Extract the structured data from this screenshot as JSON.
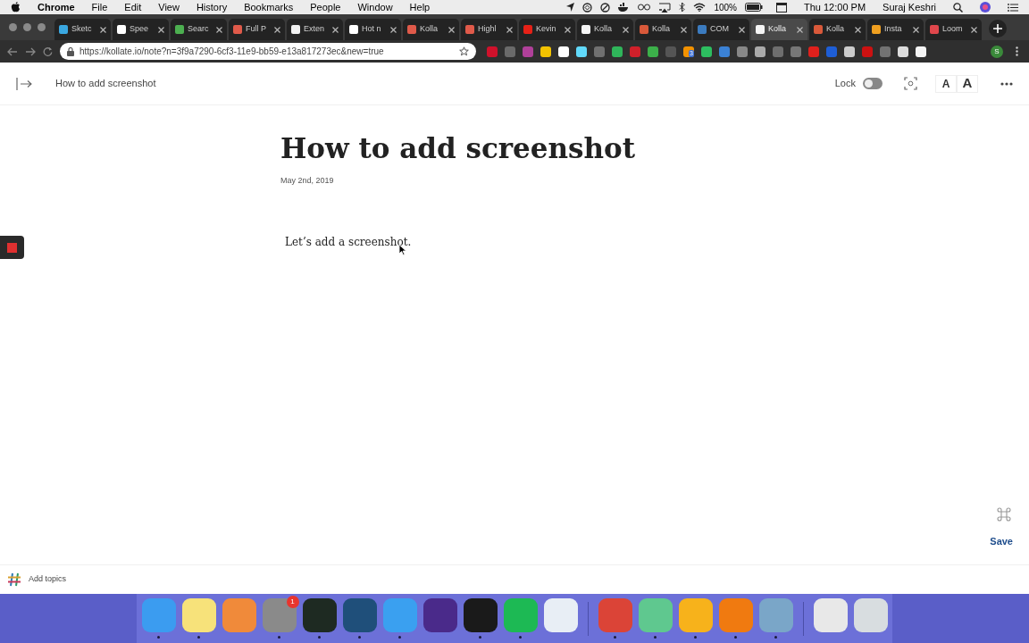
{
  "menu_bar": {
    "app": "Chrome",
    "items": [
      "File",
      "Edit",
      "View",
      "History",
      "Bookmarks",
      "People",
      "Window",
      "Help"
    ],
    "battery": "100%",
    "clock": "Thu 12:00 PM",
    "user": "Suraj Keshri"
  },
  "tabs": [
    {
      "label": "Sketc",
      "selected": false,
      "color": "#3aa7e0"
    },
    {
      "label": "Spee",
      "selected": false,
      "color": "#ffffff"
    },
    {
      "label": "Searc",
      "selected": false,
      "color": "#4caf50"
    },
    {
      "label": "Full P",
      "selected": false,
      "color": "#e05a4a"
    },
    {
      "label": "Exten",
      "selected": false,
      "color": "#f0f0f0"
    },
    {
      "label": "Hot n",
      "selected": false,
      "color": "#ffffff"
    },
    {
      "label": "Kolla",
      "selected": false,
      "color": "#e05a4a"
    },
    {
      "label": "Highl",
      "selected": false,
      "color": "#e05a4a"
    },
    {
      "label": "Kevin",
      "selected": false,
      "color": "#e62117"
    },
    {
      "label": "Kolla",
      "selected": false,
      "color": "#f5f5f5"
    },
    {
      "label": "Kolla",
      "selected": false,
      "color": "#d9593a"
    },
    {
      "label": "COM",
      "selected": false,
      "color": "#3b7bbf"
    },
    {
      "label": "Kolla",
      "selected": true,
      "color": "#f5f5f5"
    },
    {
      "label": "Kolla",
      "selected": false,
      "color": "#d9593a"
    },
    {
      "label": "Insta",
      "selected": false,
      "color": "#f0a020"
    },
    {
      "label": "Loom",
      "selected": false,
      "color": "#e0474c"
    }
  ],
  "address_bar": {
    "url": "https://kollate.io/note?n=3f9a7290-6cf3-11e9-bb59-e13a817273ec&new=true"
  },
  "extensions": [
    {
      "color": "#d0112b"
    },
    {
      "color": "#6a6a6a"
    },
    {
      "color": "#b0409a"
    },
    {
      "color": "#f2c200"
    },
    {
      "color": "#ffffff"
    },
    {
      "color": "#61dafb"
    },
    {
      "color": "#707070"
    },
    {
      "color": "#2fb55a"
    },
    {
      "color": "#d0202a"
    },
    {
      "color": "#3cb04a"
    },
    {
      "color": "#555555"
    },
    {
      "color": "#f39200",
      "badge": "3"
    },
    {
      "color": "#2dbe60"
    },
    {
      "color": "#3b82d6"
    },
    {
      "color": "#888888"
    },
    {
      "color": "#aaaaaa"
    },
    {
      "color": "#6e6e6e"
    },
    {
      "color": "#777777"
    },
    {
      "color": "#e0201c"
    },
    {
      "color": "#1e5ed6"
    },
    {
      "color": "#cccccc"
    },
    {
      "color": "#cc1111"
    },
    {
      "color": "#727272"
    },
    {
      "color": "#dddddd"
    },
    {
      "color": "#f5f5f5"
    }
  ],
  "profile": "S",
  "app_header": {
    "title": "How to add screenshot",
    "lock_label": "Lock",
    "lock_on": false,
    "font_buttons": [
      "A",
      "A"
    ]
  },
  "document": {
    "title": "How to add screenshot",
    "date": "May 2nd, 2019",
    "body": "Let’s add a screenshot."
  },
  "save_button": "Save",
  "footer": {
    "topics": "Add topics"
  },
  "dock": [
    {
      "color": "#3b9cf0",
      "running": true
    },
    {
      "color": "#f7e27a",
      "running": true
    },
    {
      "color": "#f08a3a",
      "running": false
    },
    {
      "color": "#8a8a8a",
      "running": true,
      "badge": "1"
    },
    {
      "color": "#1e2a22",
      "running": true
    },
    {
      "color": "#1f4f7a",
      "running": true
    },
    {
      "color": "#3aa0f0",
      "running": true
    },
    {
      "color": "#4a2a8a",
      "running": false
    },
    {
      "color": "#1a1a1a",
      "running": true
    },
    {
      "color": "#1db954",
      "running": true
    },
    {
      "color": "#e8eef5",
      "running": false
    },
    {
      "color": "#db4437",
      "running": true
    },
    {
      "color": "#5fc88f",
      "running": true
    },
    {
      "color": "#f7b21b",
      "running": true
    },
    {
      "color": "#f07a10",
      "running": true
    },
    {
      "color": "#7aa6c8",
      "running": true
    },
    {
      "color": "#e8e8e8",
      "running": false
    },
    {
      "color": "#d8dde0",
      "running": false
    }
  ]
}
